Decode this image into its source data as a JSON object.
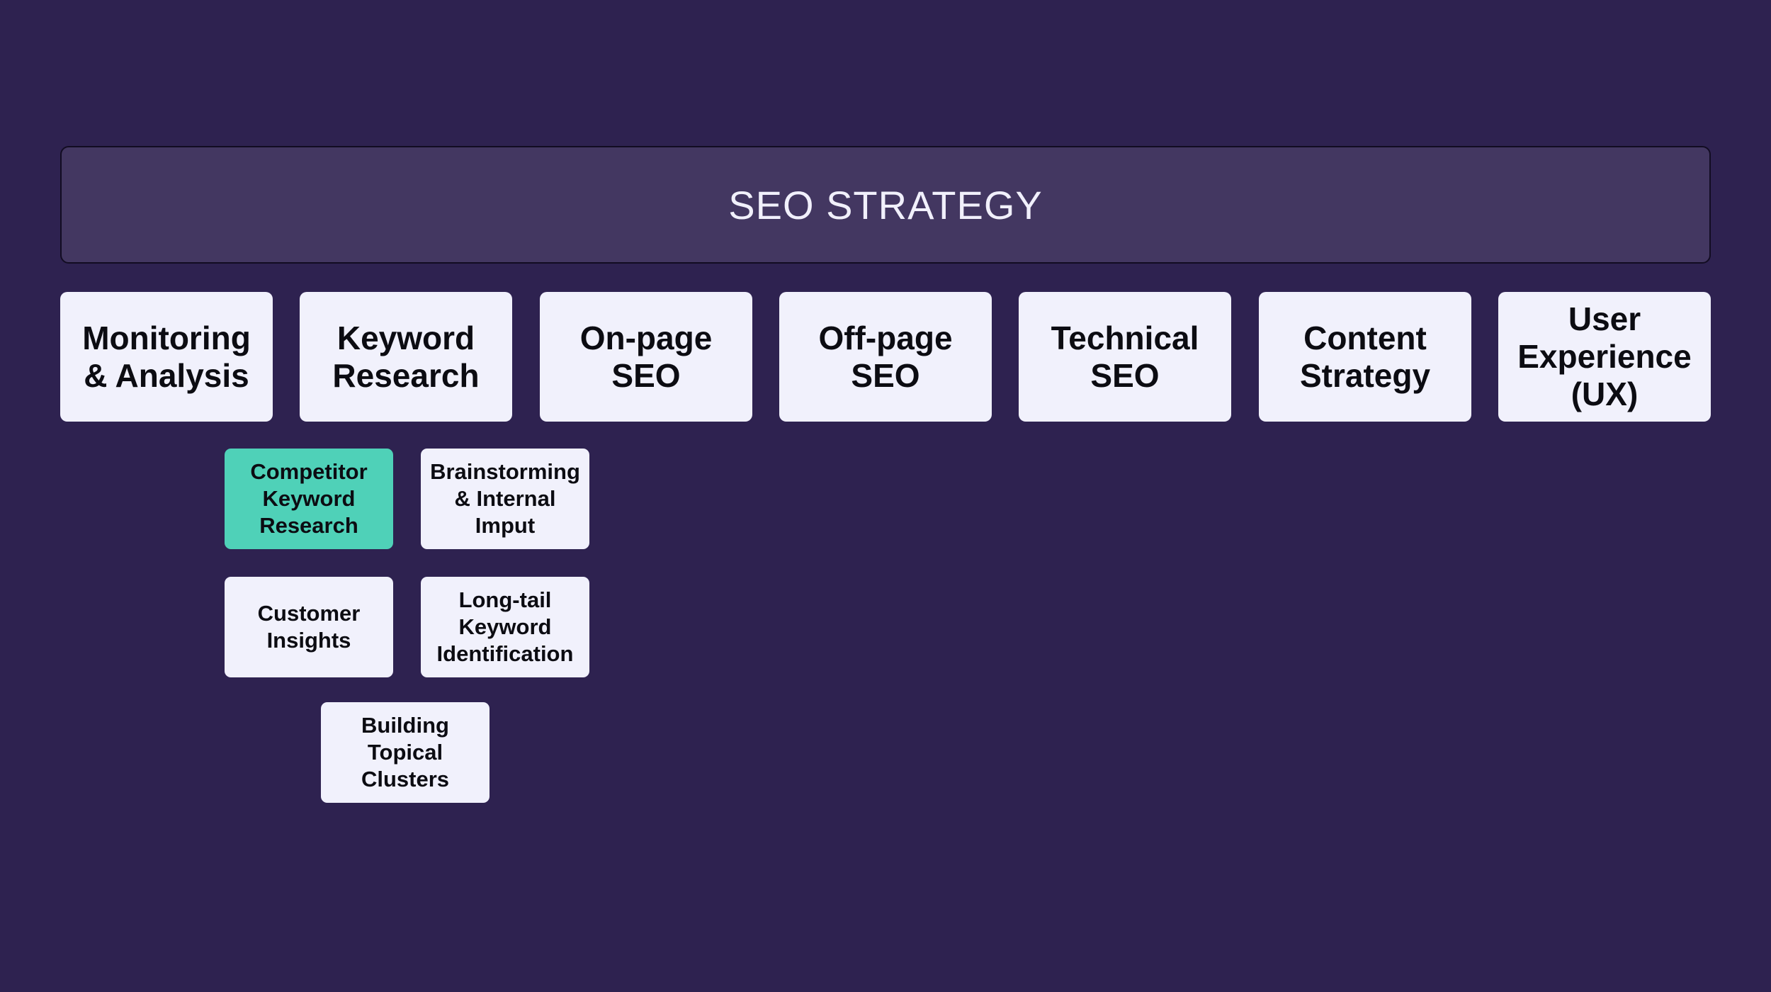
{
  "title": "SEO STRATEGY",
  "colors": {
    "background": "#2e2250",
    "banner": "#433761",
    "box": "#f1f1fc",
    "highlight": "#4fd1b8",
    "text_dark": "#0c0c12",
    "text_light": "#f1f0fb"
  },
  "categories": [
    {
      "label": "Monitoring\n& Analysis"
    },
    {
      "label": "Keyword\nResearch"
    },
    {
      "label": "On-page\nSEO"
    },
    {
      "label": "Off-page\nSEO"
    },
    {
      "label": "Technical\nSEO"
    },
    {
      "label": "Content\nStrategy"
    },
    {
      "label": "User\nExperience\n(UX)"
    }
  ],
  "keyword_research_children": [
    {
      "label": "Competitor\nKeyword\nResearch",
      "highlighted": true
    },
    {
      "label": "Brainstorming\n& Internal\nImput",
      "highlighted": false
    },
    {
      "label": "Customer\nInsights",
      "highlighted": false
    },
    {
      "label": "Long-tail\nKeyword\nIdentification",
      "highlighted": false
    },
    {
      "label": "Building\nTopical\nClusters",
      "highlighted": false
    }
  ]
}
